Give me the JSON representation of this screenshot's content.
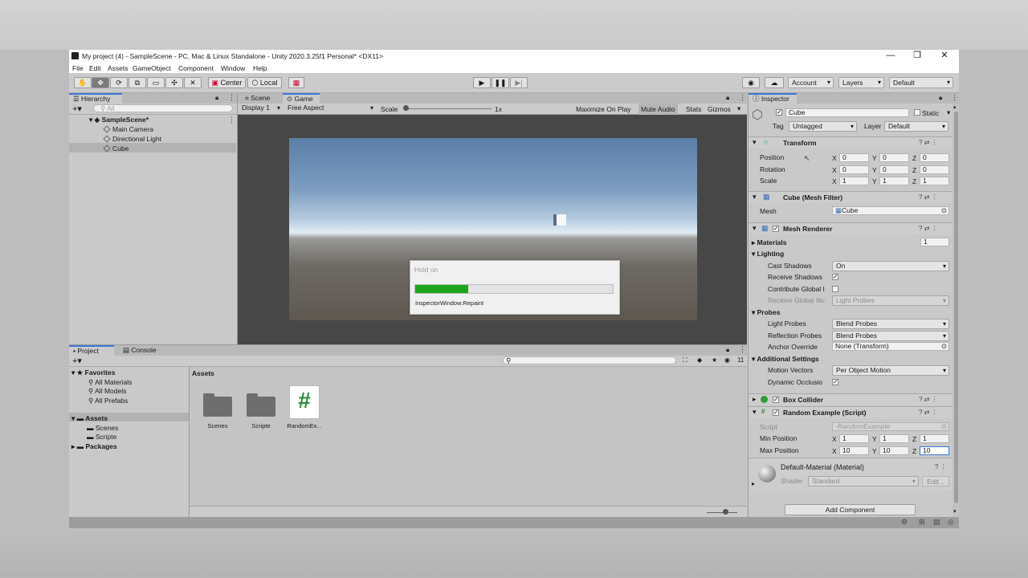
{
  "window": {
    "title": "My project (4) - SampleScene - PC, Mac & Linux Standalone - Unity 2020.3.25f1 Personal* <DX11>",
    "controls": {
      "minimize": "—",
      "maximize": "❐",
      "close": "✕"
    }
  },
  "menu": [
    "File",
    "Edit",
    "Assets",
    "GameObject",
    "Component",
    "Window",
    "Help"
  ],
  "toolbar": {
    "pivot_mode": "Center",
    "pivot_rotation": "Local",
    "account": "Account",
    "layers": "Layers",
    "layout": "Default"
  },
  "hierarchy": {
    "tab": "Hierarchy",
    "search_placeholder": "All",
    "scene": "SampleScene*",
    "items": [
      "Main Camera",
      "Directional Light",
      "Cube"
    ],
    "selected": "Cube"
  },
  "scene_tabs": {
    "scene": "Scene",
    "game": "Game"
  },
  "game_view": {
    "display": "Display 1",
    "aspect": "Free Aspect",
    "scale_label": "Scale",
    "scale_value": "1x",
    "maximize_on_play": "Maximize On Play",
    "mute_audio": "Mute Audio",
    "stats": "Stats",
    "gizmos": "Gizmos"
  },
  "progress_dialog": {
    "title": "Hold on",
    "progress": 0.27,
    "message": "InspectorWindow.Repaint",
    "bar_color": "#1ea51e"
  },
  "project": {
    "tabs": {
      "project": "Project",
      "console": "Console"
    },
    "count": "11",
    "favorites": {
      "label": "Favorites",
      "items": [
        "All Materials",
        "All Models",
        "All Prefabs"
      ]
    },
    "assets_root": "Assets",
    "asset_folders": [
      "Scenes",
      "Scripte"
    ],
    "packages": "Packages",
    "breadcrumb": "Assets",
    "grid_items": [
      {
        "name": "Scenes",
        "type": "folder"
      },
      {
        "name": "Scripte",
        "type": "folder"
      },
      {
        "name": "RandomEx...",
        "type": "script",
        "glyph": "#"
      }
    ]
  },
  "inspector": {
    "tab": "Inspector",
    "object_name": "Cube",
    "static_label": "Static",
    "tag_label": "Tag",
    "tag_value": "Untagged",
    "layer_label": "Layer",
    "layer_value": "Default",
    "transform": {
      "title": "Transform",
      "position_label": "Position",
      "rotation_label": "Rotation",
      "scale_label": "Scale",
      "position": [
        "0",
        "0",
        "0"
      ],
      "rotation": [
        "0",
        "0",
        "0"
      ],
      "scale": [
        "1",
        "1",
        "1"
      ]
    },
    "mesh_filter": {
      "title": "Cube (Mesh Filter)",
      "mesh_label": "Mesh",
      "mesh_value": "Cube"
    },
    "mesh_renderer": {
      "title": "Mesh Renderer",
      "materials_label": "Materials",
      "materials_count": "1",
      "lighting_label": "Lighting",
      "cast_shadows_label": "Cast Shadows",
      "cast_shadows_value": "On",
      "receive_shadows_label": "Receive Shadows",
      "contribute_gi_label": "Contribute Global I",
      "receive_gi_label": "Receive Global Illu",
      "receive_gi_value": "Light Probes",
      "probes_label": "Probes",
      "light_probes_label": "Light Probes",
      "light_probes_value": "Blend Probes",
      "reflection_probes_label": "Reflection Probes",
      "reflection_probes_value": "Blend Probes",
      "anchor_override_label": "Anchor Override",
      "anchor_override_value": "None (Transform)",
      "additional_settings_label": "Additional Settings",
      "motion_vectors_label": "Motion Vectors",
      "motion_vectors_value": "Per Object Motion",
      "dynamic_occlusion_label": "Dynamic Occlusio"
    },
    "box_collider": {
      "title": "Box Collider"
    },
    "random_example": {
      "title": "Random Example (Script)",
      "script_label": "Script",
      "script_value": "RandomExample",
      "min_label": "Min Position",
      "max_label": "Max Position",
      "min": [
        "1",
        "1",
        "1"
      ],
      "max": [
        "10",
        "10",
        "10"
      ]
    },
    "material": {
      "title": "Default-Material (Material)",
      "shader_label": "Shader",
      "shader_value": "Standard",
      "edit_label": "Edit..."
    },
    "add_component": "Add Component",
    "axis_labels": [
      "X",
      "Y",
      "Z"
    ]
  }
}
